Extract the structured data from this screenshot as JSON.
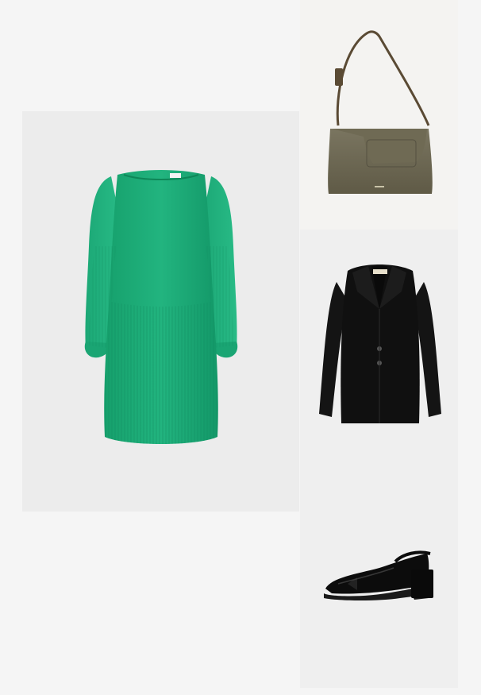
{
  "outfit": {
    "items": [
      {
        "icon": "dress-image",
        "color": "#1fae7a"
      },
      {
        "icon": "shoulder-bag-image",
        "color": "#6b6650"
      },
      {
        "icon": "blazer-image",
        "color": "#111111"
      },
      {
        "icon": "slingback-shoe-image",
        "color": "#0c0c0c"
      }
    ],
    "background_color": "#f5f5f5"
  }
}
